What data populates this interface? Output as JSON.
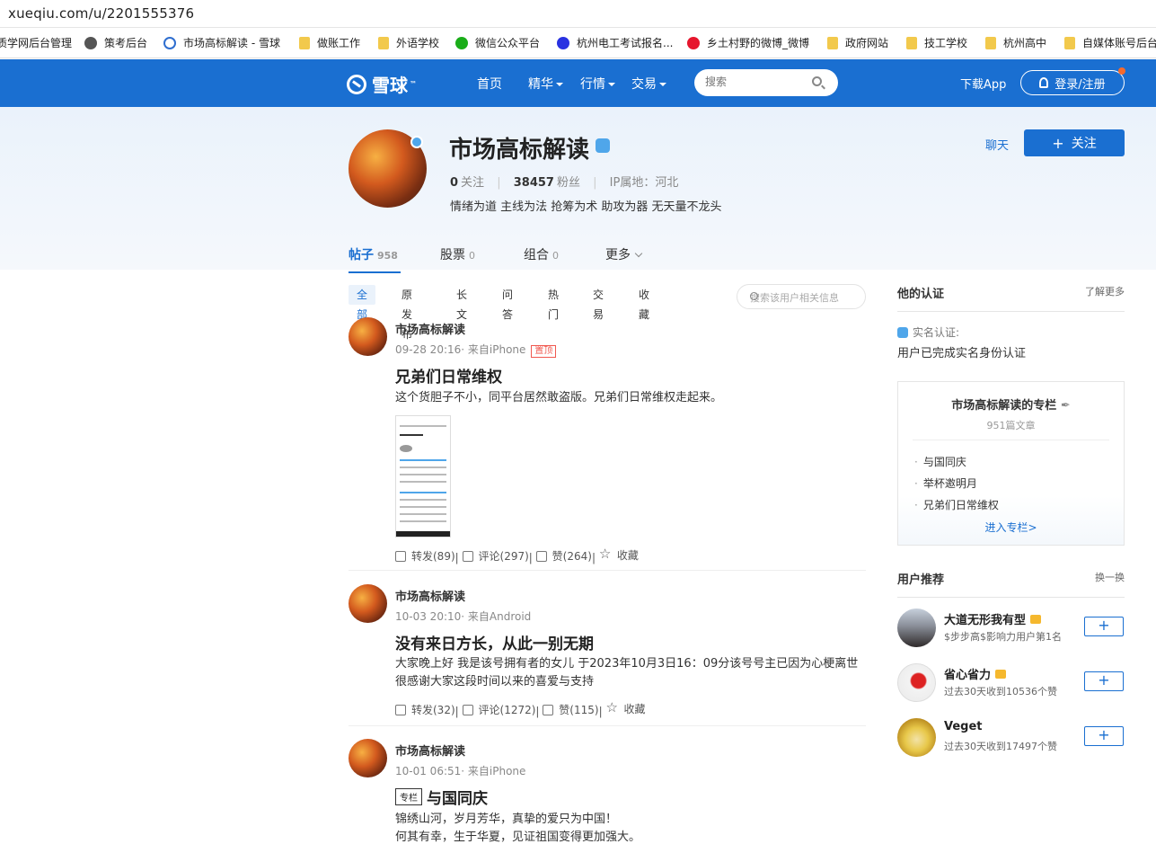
{
  "browser": {
    "url": "xueqiu.com/u/2201555376",
    "bookmarks": [
      {
        "label": "质学网后台管理",
        "icon": "none-icon"
      },
      {
        "label": "策考后台",
        "icon": "globe-icon"
      },
      {
        "label": "市场高标解读 - 雪球",
        "icon": "xueqiu-icon"
      },
      {
        "label": "做账工作",
        "icon": "folder-icon"
      },
      {
        "label": "外语学校",
        "icon": "folder-icon"
      },
      {
        "label": "微信公众平台",
        "icon": "wechat-icon"
      },
      {
        "label": "杭州电工考试报名...",
        "icon": "baidu-icon"
      },
      {
        "label": "乡土村野的微博_微博",
        "icon": "weibo-icon"
      },
      {
        "label": "政府网站",
        "icon": "folder-icon"
      },
      {
        "label": "技工学校",
        "icon": "folder-icon"
      },
      {
        "label": "杭州高中",
        "icon": "folder-icon"
      },
      {
        "label": "自媒体账号后台",
        "icon": "folder-icon"
      }
    ]
  },
  "nav": {
    "logo": "雪球",
    "logo_tm": "™",
    "items": [
      "首页",
      "精华",
      "行情",
      "交易"
    ],
    "search_placeholder": "搜索",
    "download": "下载App",
    "login": "登录/注册"
  },
  "profile": {
    "name": "市场高标解读",
    "following_count": "0",
    "following_label": "关注",
    "followers_count": "38457",
    "followers_label": "粉丝",
    "ip": "IP属地：河北",
    "bio": "情绪为道 主线为法 抢筹为术 助攻为器 无天量不龙头",
    "chat": "聊天",
    "follow": "关注",
    "tabs": [
      {
        "label": "帖子",
        "count": "958"
      },
      {
        "label": "股票",
        "count": "0"
      },
      {
        "label": "组合",
        "count": "0"
      },
      {
        "label": "更多",
        "count": ""
      }
    ]
  },
  "filters": {
    "items": [
      "全部",
      "原发布",
      "长文",
      "问答",
      "热门",
      "交易",
      "收藏"
    ],
    "search_placeholder": "搜索该用户相关信息"
  },
  "posts": [
    {
      "author": "市场高标解读",
      "meta": "09-28 20:16· 来自iPhone",
      "pin": "置顶",
      "title": "兄弟们日常维权",
      "body": "这个货胆子不小，同平台居然敢盗版。兄弟们日常维权走起来。",
      "repost": "转发(89)",
      "comment": "评论(297)",
      "like": "赞(264)",
      "fav": "收藏"
    },
    {
      "author": "市场高标解读",
      "meta": "10-03 20:10· 来自Android",
      "title": "没有来日方长，从此一别无期",
      "body": "大家晚上好 我是该号拥有者的女儿 于2023年10月3日16：09分该号号主已因为心梗离世 很感谢大家这段时间以来的喜爱与支持",
      "repost": "转发(32)",
      "comment": "评论(1272)",
      "like": "赞(115)",
      "fav": "收藏"
    },
    {
      "author": "市场高标解读",
      "meta": "10-01 06:51· 来自iPhone",
      "tag": "专栏",
      "title": "与国同庆",
      "body": "锦绣山河，岁月芳华，真挚的爱只为中国！\n何其有幸，生于华夏，见证祖国变得更加强大。"
    }
  ],
  "sidebar": {
    "cert_title": "他的认证",
    "cert_more": "了解更多",
    "cert_label": "实名认证:",
    "cert_text": "用户已完成实名身份认证",
    "column_title": "市场高标解读的专栏",
    "column_count": "951篇文章",
    "column_items": [
      "与国同庆",
      "举杯邀明月",
      "兄弟们日常维权"
    ],
    "column_enter": "进入专栏>",
    "rec_title": "用户推荐",
    "rec_refresh": "换一换",
    "recommendations": [
      {
        "name": "大道无形我有型",
        "desc": "$步步高$影响力用户第1名",
        "crown": true
      },
      {
        "name": "省心省力",
        "desc": "过去30天收到10536个赞",
        "crown": true
      },
      {
        "name": "Veget",
        "desc": "过去30天收到17497个赞",
        "crown": false
      }
    ],
    "add_label": "+"
  }
}
